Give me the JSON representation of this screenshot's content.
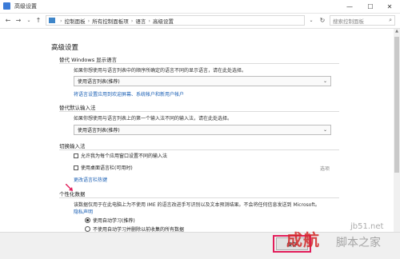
{
  "window": {
    "title": "高级设置",
    "minimize": "—",
    "maximize": "☐",
    "close": "✕"
  },
  "address_bar": {
    "crumbs": [
      "控制面板",
      "所有控制面板项",
      "语言",
      "高级设置"
    ],
    "separator": "›",
    "search_placeholder": "搜索控制面板"
  },
  "page": {
    "title": "高级设置",
    "display_language": {
      "header": "替代 Windows 显示语言",
      "description": "如果你想使用与语言列表中的顺序所确定的语言不同的显示语言，请在此处选择。",
      "selected": "使用语言列表(推荐)",
      "link": "将语言设置应用到欢迎屏幕、系统帐户和新用户帐户"
    },
    "default_input": {
      "header": "替代默认输入法",
      "description": "如果你想使用与语言列表上的第一个输入法不同的输入法，请在此处选择。",
      "selected": "使用语言列表(推荐)"
    },
    "switch_input": {
      "header": "切换输入法",
      "option1": "允许我为每个应用窗口设置不同的输入法",
      "option2": "使用桌面语言栏(可用时)",
      "options_link": "选项",
      "hotkey_link": "更改语言栏热键"
    },
    "personalization": {
      "header": "个性化数据",
      "description": "该数据仅用于在此电脑上为不使用 IME 的语言改进手写识别以及文本预测结果。不会将任何信息发送到 Microsoft。",
      "privacy_link": "隐私声明",
      "radio1": "使用自动学习(推荐)",
      "radio2": "不使用自动学习并删除以前收集的所有数据"
    }
  },
  "footer": {
    "save_label": "保存"
  },
  "watermark": {
    "line1": "成航",
    "line2": "jb51.net",
    "line3": "脚本之家"
  },
  "colors": {
    "accent": "#1a5fb4",
    "highlight": "#e21d5a"
  }
}
